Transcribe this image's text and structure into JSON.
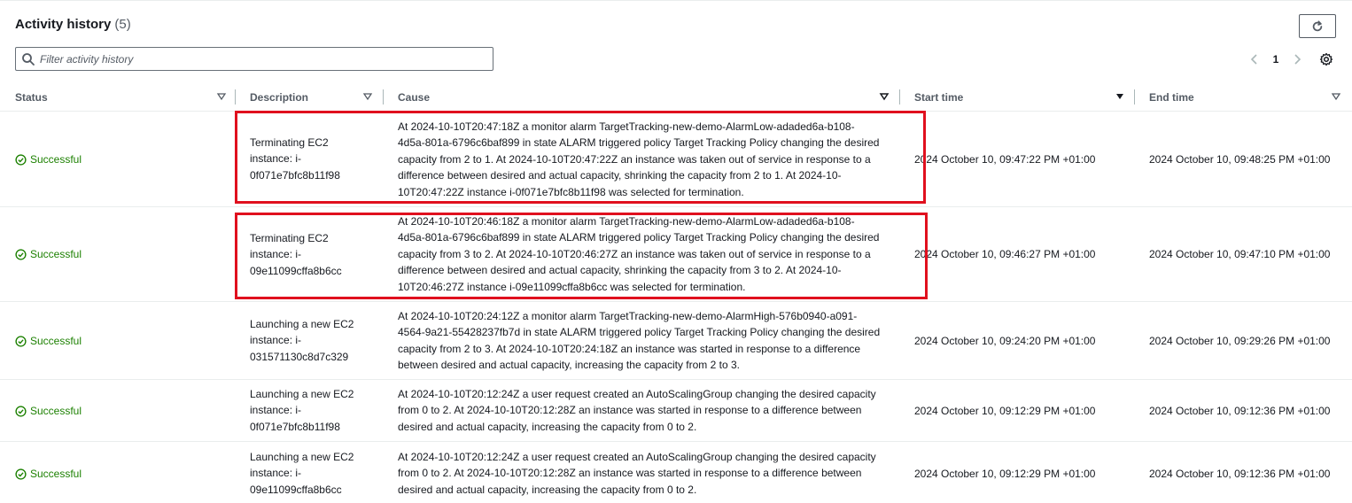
{
  "header": {
    "title": "Activity history",
    "count": "(5)"
  },
  "search": {
    "placeholder": "Filter activity history",
    "value": ""
  },
  "pagination": {
    "current_page": "1"
  },
  "columns": [
    "Status",
    "Description",
    "Cause",
    "Start time",
    "End time"
  ],
  "rows": [
    {
      "status": "Successful",
      "description": [
        "Terminating EC2",
        "instance: i-",
        "0f071e7bfc8b11f98"
      ],
      "cause": [
        "At 2024-10-10T20:47:18Z a monitor alarm TargetTracking-new-demo-AlarmLow-adaded6a-b108-",
        "4d5a-801a-6796c6baf899 in state ALARM triggered policy Target Tracking Policy changing the desired",
        "capacity from 2 to 1. At 2024-10-10T20:47:22Z an instance was taken out of service in response to a",
        "difference between desired and actual capacity, shrinking the capacity from 2 to 1. At 2024-10-",
        "10T20:47:22Z instance i-0f071e7bfc8b11f98 was selected for termination."
      ],
      "start_time": "2024 October 10, 09:47:22 PM +01:00",
      "end_time": "2024 October 10, 09:48:25 PM +01:00"
    },
    {
      "status": "Successful",
      "description": [
        "Terminating EC2",
        "instance: i-",
        "09e11099cffa8b6cc"
      ],
      "cause": [
        "At 2024-10-10T20:46:18Z a monitor alarm TargetTracking-new-demo-AlarmLow-adaded6a-b108-",
        "4d5a-801a-6796c6baf899 in state ALARM triggered policy Target Tracking Policy changing the desired",
        "capacity from 3 to 2. At 2024-10-10T20:46:27Z an instance was taken out of service in response to a",
        "difference between desired and actual capacity, shrinking the capacity from 3 to 2. At 2024-10-",
        "10T20:46:27Z instance i-09e11099cffa8b6cc was selected for termination."
      ],
      "start_time": "2024 October 10, 09:46:27 PM +01:00",
      "end_time": "2024 October 10, 09:47:10 PM +01:00"
    },
    {
      "status": "Successful",
      "description": [
        "Launching a new EC2",
        "instance: i-",
        "031571130c8d7c329"
      ],
      "cause": [
        "At 2024-10-10T20:24:12Z a monitor alarm TargetTracking-new-demo-AlarmHigh-576b0940-a091-",
        "4564-9a21-55428237fb7d in state ALARM triggered policy Target Tracking Policy changing the desired",
        "capacity from 2 to 3. At 2024-10-10T20:24:18Z an instance was started in response to a difference",
        "between desired and actual capacity, increasing the capacity from 2 to 3."
      ],
      "start_time": "2024 October 10, 09:24:20 PM +01:00",
      "end_time": "2024 October 10, 09:29:26 PM +01:00"
    },
    {
      "status": "Successful",
      "description": [
        "Launching a new EC2",
        "instance: i-",
        "0f071e7bfc8b11f98"
      ],
      "cause": [
        "At 2024-10-10T20:12:24Z a user request created an AutoScalingGroup changing the desired capacity",
        "from 0 to 2. At 2024-10-10T20:12:28Z an instance was started in response to a difference between",
        "desired and actual capacity, increasing the capacity from 0 to 2."
      ],
      "start_time": "2024 October 10, 09:12:29 PM +01:00",
      "end_time": "2024 October 10, 09:12:36 PM +01:00"
    },
    {
      "status": "Successful",
      "description": [
        "Launching a new EC2",
        "instance: i-",
        "09e11099cffa8b6cc"
      ],
      "cause": [
        "At 2024-10-10T20:12:24Z a user request created an AutoScalingGroup changing the desired capacity",
        "from 0 to 2. At 2024-10-10T20:12:28Z an instance was started in response to a difference between",
        "desired and actual capacity, increasing the capacity from 0 to 2."
      ],
      "start_time": "2024 October 10, 09:12:29 PM +01:00",
      "end_time": "2024 October 10, 09:12:36 PM +01:00"
    }
  ],
  "colors": {
    "success": "#1d8102",
    "highlight": "#e0101e",
    "text": "#16191f",
    "muted": "#545b64"
  }
}
